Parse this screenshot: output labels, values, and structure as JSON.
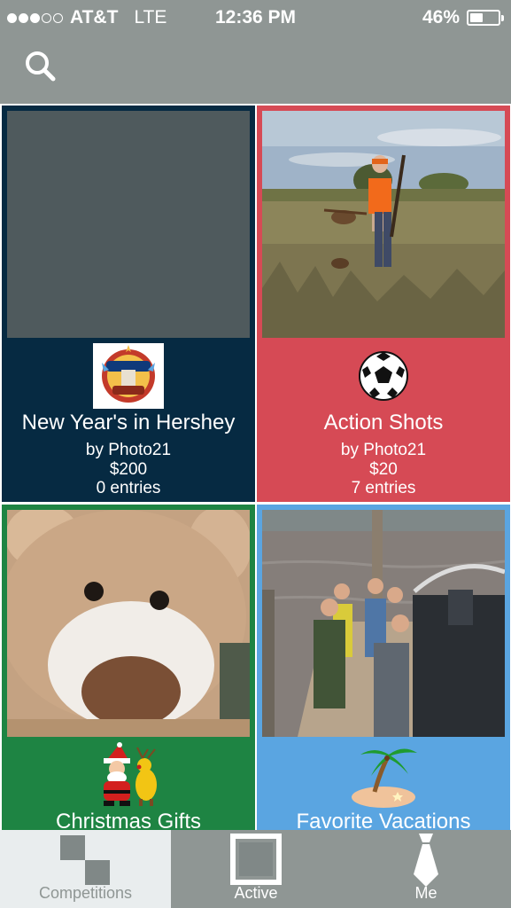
{
  "status_bar": {
    "signal_dots_filled": 3,
    "signal_dots_total": 5,
    "carrier": "AT&T",
    "network": "LTE",
    "time": "12:36 PM",
    "battery_percent": "46%"
  },
  "header": {
    "search_icon": "search-icon"
  },
  "competitions": [
    {
      "title": "New Year's in Hershey",
      "by": "by Photo21",
      "prize": "$200",
      "entries": "0 entries",
      "color": "#062a42",
      "badge_icon": "hershey-new-year-badge-icon"
    },
    {
      "title": "Action Shots",
      "by": "by Photo21",
      "prize": "$20",
      "entries": "7 entries",
      "color": "#d64a55",
      "badge_icon": "soccer-ball-icon"
    },
    {
      "title": "Christmas Gifts",
      "color": "#1e8443",
      "badge_icon": "santa-reindeer-icon"
    },
    {
      "title": "Favorite Vacations",
      "color": "#5aa5e1",
      "badge_icon": "palm-island-icon"
    }
  ],
  "tabbar": {
    "tabs": [
      {
        "label": "Competitions",
        "icon": "competitions-icon",
        "selected": true
      },
      {
        "label": "Active",
        "icon": "active-square-icon"
      },
      {
        "label": "Me",
        "icon": "tie-icon"
      }
    ]
  },
  "colors": {
    "header": "#8f9694",
    "tab_selected_bg": "#e9edee"
  }
}
